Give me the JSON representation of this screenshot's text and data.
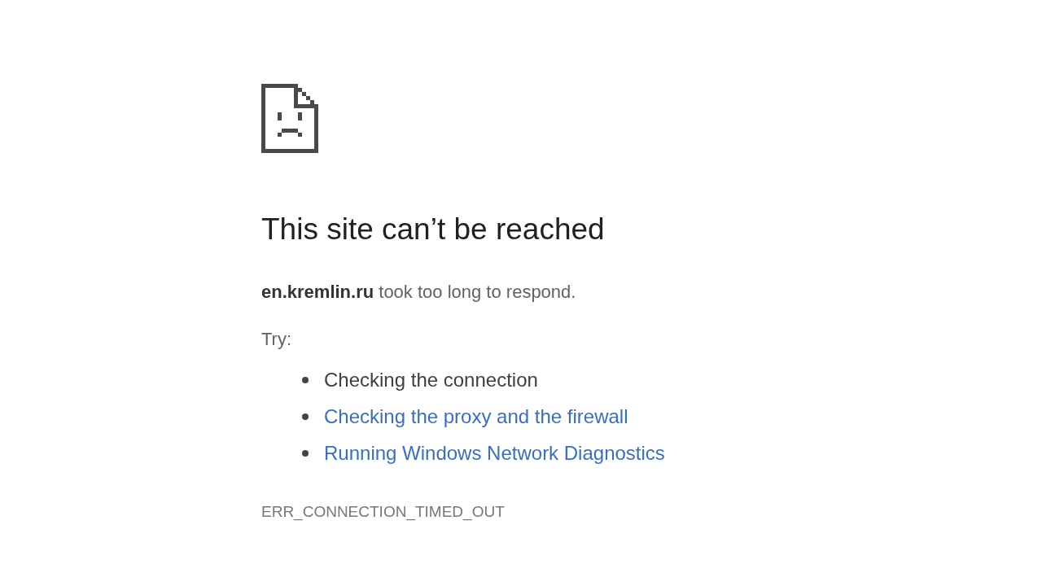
{
  "title": "This site can’t be reached",
  "message": "**en.kremlin.ru** took too long to respond.",
  "try_label": "Try:",
  "suggestions": [
    {
      "kind": "text",
      "text": "Checking the connection"
    },
    {
      "kind": "link",
      "text": "Checking the proxy and the firewall"
    },
    {
      "kind": "link",
      "text": "Running Windows Network Diagnostics"
    }
  ],
  "error_code": "ERR_CONNECTION_TIMED_OUT"
}
